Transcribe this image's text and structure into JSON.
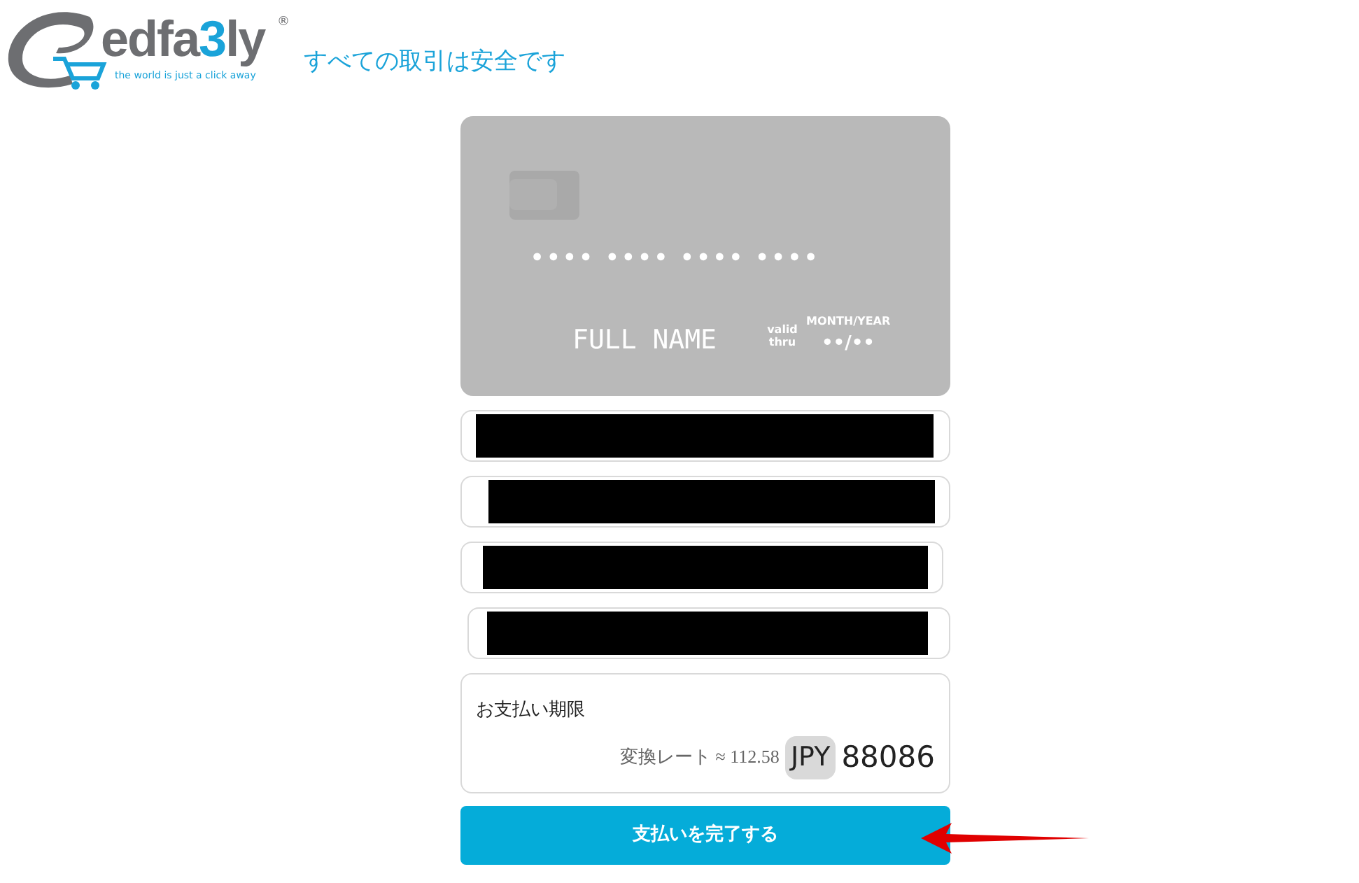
{
  "header": {
    "logo": {
      "parts": [
        "edfa",
        "3",
        "ly"
      ],
      "registered": "®",
      "slogan": "the world is just a click away"
    },
    "tagline": "すべての取引は安全です"
  },
  "card_preview": {
    "number": "•••• •••• •••• ••••",
    "name": "FULL NAME",
    "valid_label": "valid thru",
    "expiry_label": "MONTH/YEAR",
    "expiry": "••/••"
  },
  "fields": [
    {
      "redacted": true
    },
    {
      "redacted": true
    },
    {
      "redacted": true
    },
    {
      "redacted": true
    }
  ],
  "summary": {
    "label": "お支払い期限",
    "rate": "変換レート ≈ 112.58",
    "currency": "JPY",
    "amount": "88086"
  },
  "submit_button": "支払いを完了する"
}
